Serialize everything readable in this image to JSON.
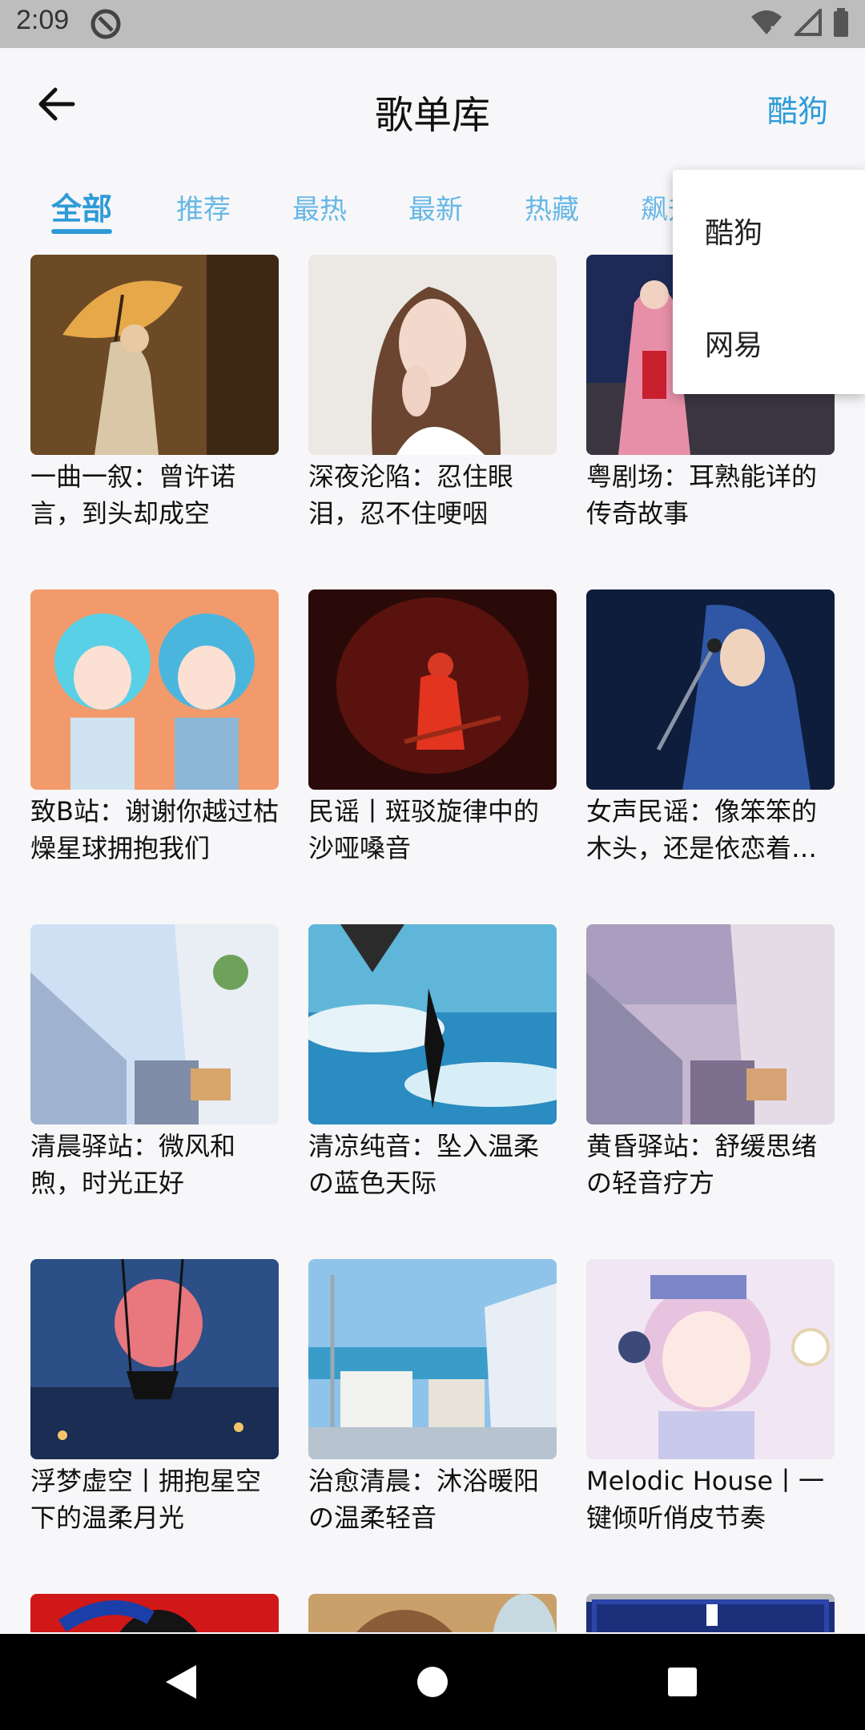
{
  "status_bar": {
    "time": "2:09"
  },
  "app_bar": {
    "title": "歌单库",
    "source_label": "酷狗"
  },
  "tabs": [
    {
      "label": "全部",
      "active": true
    },
    {
      "label": "推荐"
    },
    {
      "label": "最热"
    },
    {
      "label": "最新"
    },
    {
      "label": "热藏"
    },
    {
      "label": "飙升"
    }
  ],
  "dropdown": {
    "items": [
      "酷狗",
      "网易"
    ]
  },
  "playlists": [
    {
      "title": "一曲一叙：曾许诺言，到头却成空",
      "cover": "umbrella"
    },
    {
      "title": "深夜沦陷：忍住眼泪，忍不住哽咽",
      "cover": "portrait"
    },
    {
      "title": "粤剧场：耳熟能详的传奇故事",
      "cover": "opera"
    },
    {
      "title": "致B站：谢谢你越过枯燥星球拥抱我们",
      "cover": "anime"
    },
    {
      "title": "民谣丨斑驳旋律中的沙哑嗓音",
      "cover": "stage"
    },
    {
      "title": "女声民谣：像笨笨的木头，还是依恋着…",
      "cover": "singer"
    },
    {
      "title": "清晨驿站：微风和煦，时光正好",
      "cover": "station-day"
    },
    {
      "title": "清凉纯音：坠入温柔の蓝色天际",
      "cover": "sky"
    },
    {
      "title": "黄昏驿站：舒缓思绪の轻音疗方",
      "cover": "station-dusk"
    },
    {
      "title": "浮梦虚空丨拥抱星空下的温柔月光",
      "cover": "moon"
    },
    {
      "title": "治愈清晨：沐浴暖阳の温柔轻音",
      "cover": "town"
    },
    {
      "title": "Melodic House丨一键倾听俏皮节奏",
      "cover": "anime-girl"
    },
    {
      "title": "",
      "cover": "red"
    },
    {
      "title": "",
      "cover": "warm"
    },
    {
      "title": "",
      "cover": "curtain"
    }
  ],
  "colors": {
    "accent": "#2e9bd8",
    "tab_inactive": "#67b7e6",
    "status_bar": "#bdbdbd",
    "nav_bar": "#000000"
  }
}
